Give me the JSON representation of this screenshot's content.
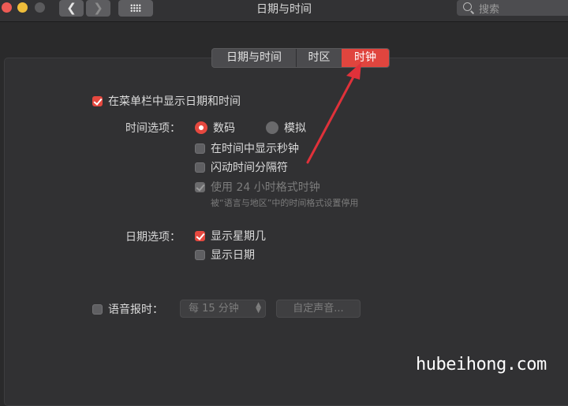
{
  "window": {
    "title": "日期与时间",
    "search_placeholder": "搜索"
  },
  "tabs": [
    {
      "label": "日期与时间",
      "selected": false
    },
    {
      "label": "时区",
      "selected": false
    },
    {
      "label": "时钟",
      "selected": true
    }
  ],
  "show_in_menubar": {
    "label": "在菜单栏中显示日期和时间",
    "checked": true
  },
  "time_options": {
    "label": "时间选项：",
    "radios": [
      {
        "label": "数码",
        "selected": true
      },
      {
        "label": "模拟",
        "selected": false
      }
    ],
    "show_seconds": {
      "label": "在时间中显示秒钟",
      "checked": false
    },
    "flash_separators": {
      "label": "闪动时间分隔符",
      "checked": false
    },
    "use_24h": {
      "label": "使用 24 小时格式时钟",
      "checked": true,
      "disabled": true
    },
    "note": "被“语言与地区”中的时间格式设置停用"
  },
  "date_options": {
    "label": "日期选项：",
    "show_weekday": {
      "label": "显示星期几",
      "checked": true
    },
    "show_date": {
      "label": "显示日期",
      "checked": false
    }
  },
  "announce": {
    "label": "语音报时：",
    "checked": false,
    "interval_value": "每 15 分钟",
    "custom_voice_label": "自定声音..."
  },
  "watermark": "hubeihong.com",
  "colors": {
    "accent": "#e5483f",
    "annotation_arrow": "#e0313a"
  }
}
